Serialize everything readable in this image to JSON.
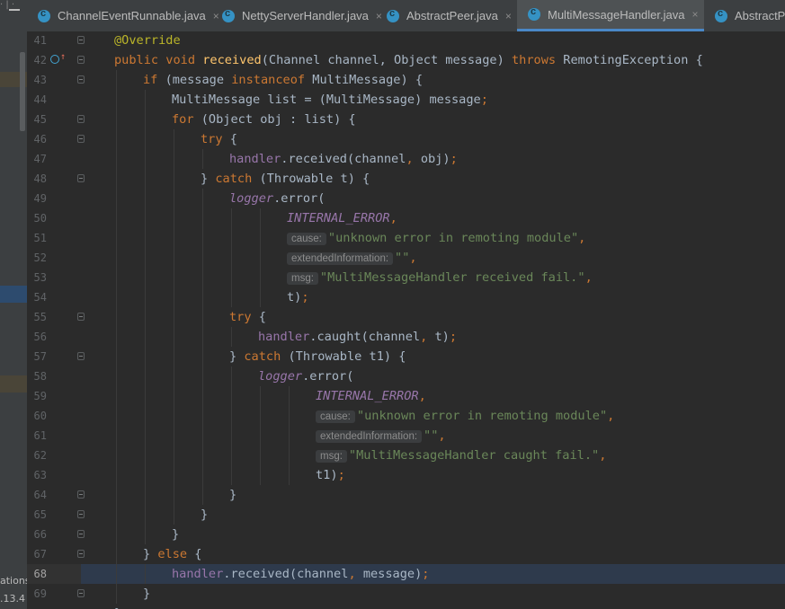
{
  "left_panel": {
    "status_1": "ations",
    "status_2": ".13.4"
  },
  "tabs": [
    {
      "label": "ChannelEventRunnable.java",
      "active": false
    },
    {
      "label": "NettyServerHandler.java",
      "active": false
    },
    {
      "label": "AbstractPeer.java",
      "active": false
    },
    {
      "label": "MultiMessageHandler.java",
      "active": true
    },
    {
      "label": "AbstractPro",
      "active": false
    }
  ],
  "close_glyph": "×",
  "lines": [
    {
      "n": "41",
      "indent": 1,
      "tokens": [
        [
          "ann",
          "@Override"
        ]
      ]
    },
    {
      "n": "42",
      "indent": 1,
      "tokens": [
        [
          "kw",
          "public void "
        ],
        [
          "fn",
          "received"
        ],
        [
          "",
          "(Channel channel, Object message) "
        ],
        [
          "kw",
          "throws "
        ],
        [
          "",
          "RemotingException {"
        ]
      ]
    },
    {
      "n": "43",
      "indent": 2,
      "tokens": [
        [
          "kw",
          "if "
        ],
        [
          "",
          "(message "
        ],
        [
          "kw",
          "instanceof "
        ],
        [
          "",
          "MultiMessage) {"
        ]
      ]
    },
    {
      "n": "44",
      "indent": 3,
      "tokens": [
        [
          "",
          "MultiMessage list = (MultiMessage) message"
        ],
        [
          "kw",
          ";"
        ]
      ]
    },
    {
      "n": "45",
      "indent": 3,
      "tokens": [
        [
          "kw",
          "for "
        ],
        [
          "",
          "(Object obj : list) {"
        ]
      ]
    },
    {
      "n": "46",
      "indent": 4,
      "tokens": [
        [
          "kw",
          "try "
        ],
        [
          "",
          "{"
        ]
      ]
    },
    {
      "n": "47",
      "indent": 5,
      "tokens": [
        [
          "fld",
          "handler"
        ],
        [
          "",
          ".received(channel"
        ],
        [
          "kw",
          ", "
        ],
        [
          "",
          "obj)"
        ],
        [
          "kw",
          ";"
        ]
      ]
    },
    {
      "n": "48",
      "indent": 4,
      "tokens": [
        [
          "",
          "} "
        ],
        [
          "kw",
          "catch "
        ],
        [
          "",
          "(Throwable t) {"
        ]
      ]
    },
    {
      "n": "49",
      "indent": 5,
      "tokens": [
        [
          "fld-it",
          "logger"
        ],
        [
          "",
          ".error("
        ]
      ]
    },
    {
      "n": "50",
      "indent": 7,
      "tokens": [
        [
          "fld-it",
          "INTERNAL_ERROR"
        ],
        [
          "kw",
          ","
        ]
      ]
    },
    {
      "n": "51",
      "indent": 7,
      "tokens": [
        [
          "hint",
          "cause:"
        ],
        [
          "str",
          "\"unknown error in remoting module\""
        ],
        [
          "kw",
          ","
        ]
      ]
    },
    {
      "n": "52",
      "indent": 7,
      "tokens": [
        [
          "hint",
          "extendedInformation:"
        ],
        [
          "str",
          "\"\""
        ],
        [
          "kw",
          ","
        ]
      ]
    },
    {
      "n": "53",
      "indent": 7,
      "tokens": [
        [
          "hint",
          "msg:"
        ],
        [
          "str",
          "\"MultiMessageHandler received fail.\""
        ],
        [
          "kw",
          ","
        ]
      ]
    },
    {
      "n": "54",
      "indent": 7,
      "tokens": [
        [
          "",
          "t)"
        ],
        [
          "kw",
          ";"
        ]
      ]
    },
    {
      "n": "55",
      "indent": 5,
      "tokens": [
        [
          "kw",
          "try "
        ],
        [
          "",
          "{"
        ]
      ]
    },
    {
      "n": "56",
      "indent": 6,
      "tokens": [
        [
          "fld",
          "handler"
        ],
        [
          "",
          ".caught(channel"
        ],
        [
          "kw",
          ", "
        ],
        [
          "",
          "t)"
        ],
        [
          "kw",
          ";"
        ]
      ]
    },
    {
      "n": "57",
      "indent": 5,
      "tokens": [
        [
          "",
          "} "
        ],
        [
          "kw",
          "catch "
        ],
        [
          "",
          "(Throwable t1) {"
        ]
      ]
    },
    {
      "n": "58",
      "indent": 6,
      "tokens": [
        [
          "fld-it",
          "logger"
        ],
        [
          "",
          ".error("
        ]
      ]
    },
    {
      "n": "59",
      "indent": 8,
      "tokens": [
        [
          "fld-it",
          "INTERNAL_ERROR"
        ],
        [
          "kw",
          ","
        ]
      ]
    },
    {
      "n": "60",
      "indent": 8,
      "tokens": [
        [
          "hint",
          "cause:"
        ],
        [
          "str",
          "\"unknown error in remoting module\""
        ],
        [
          "kw",
          ","
        ]
      ]
    },
    {
      "n": "61",
      "indent": 8,
      "tokens": [
        [
          "hint",
          "extendedInformation:"
        ],
        [
          "str",
          "\"\""
        ],
        [
          "kw",
          ","
        ]
      ]
    },
    {
      "n": "62",
      "indent": 8,
      "tokens": [
        [
          "hint",
          "msg:"
        ],
        [
          "str",
          "\"MultiMessageHandler caught fail.\""
        ],
        [
          "kw",
          ","
        ]
      ]
    },
    {
      "n": "63",
      "indent": 8,
      "tokens": [
        [
          "",
          "t1)"
        ],
        [
          "kw",
          ";"
        ]
      ]
    },
    {
      "n": "64",
      "indent": 5,
      "tokens": [
        [
          "",
          "}"
        ]
      ]
    },
    {
      "n": "65",
      "indent": 4,
      "tokens": [
        [
          "",
          "}"
        ]
      ]
    },
    {
      "n": "66",
      "indent": 3,
      "tokens": [
        [
          "",
          "}"
        ]
      ]
    },
    {
      "n": "67",
      "indent": 2,
      "tokens": [
        [
          "",
          "} "
        ],
        [
          "kw",
          "else "
        ],
        [
          "",
          "{"
        ]
      ]
    },
    {
      "n": "68",
      "indent": 3,
      "tokens": [
        [
          "fld",
          "handler"
        ],
        [
          "",
          ".received(channel"
        ],
        [
          "kw",
          ", "
        ],
        [
          "",
          "message)"
        ],
        [
          "kw",
          ";"
        ]
      ],
      "current": true
    },
    {
      "n": "69",
      "indent": 2,
      "tokens": [
        [
          "",
          "}"
        ]
      ]
    },
    {
      "n": "70",
      "indent": 1,
      "tokens": [
        [
          "",
          "}"
        ]
      ]
    }
  ]
}
